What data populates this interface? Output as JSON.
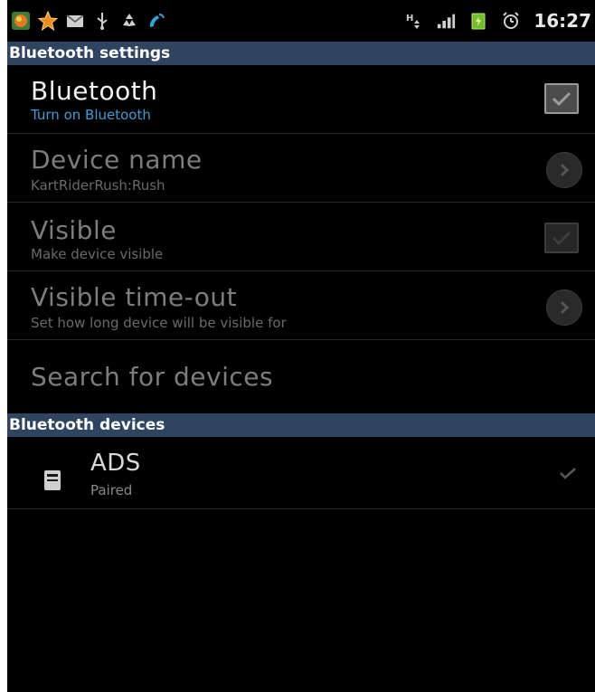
{
  "status_bar": {
    "time": "16:27",
    "icons": [
      "app-notification-icon",
      "star-icon",
      "mail-icon",
      "usb-icon",
      "recycle-icon",
      "phone-call-icon",
      "hspa-icon",
      "signal-icon",
      "battery-icon",
      "alarm-icon"
    ]
  },
  "section_settings": {
    "title": "Bluetooth settings"
  },
  "bluetooth": {
    "title": "Bluetooth",
    "subtitle": "Turn on Bluetooth",
    "checked": true
  },
  "device_name": {
    "title": "Device name",
    "subtitle": "KartRiderRush:Rush"
  },
  "visible": {
    "title": "Visible",
    "subtitle": "Make device visible",
    "checked": true,
    "enabled": false
  },
  "visible_timeout": {
    "title": "Visible time-out",
    "subtitle": "Set how long device will be visible for"
  },
  "search": {
    "title": "Search for devices"
  },
  "section_devices": {
    "title": "Bluetooth devices"
  },
  "devices": [
    {
      "name": "ADS",
      "status": "Paired"
    }
  ],
  "colors": {
    "header_bg": "#2e4460",
    "subtitle_blue": "#3b9dd6",
    "background": "#000000"
  }
}
